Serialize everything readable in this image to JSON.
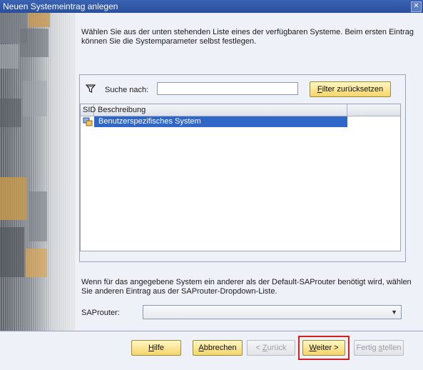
{
  "window": {
    "title": "Neuen Systemeintrag anlegen",
    "close_glyph": "✕"
  },
  "intro_text": "Wählen Sie aus der unten stehenden Liste eines der verfügbaren Systeme. Beim ersten Eintrag können Sie die Systemparameter selbst festlegen.",
  "search": {
    "label": "Suche nach:",
    "value": "",
    "placeholder": "",
    "icon": "filter-icon"
  },
  "filter_reset_button": {
    "label_accel": "F",
    "label_rest": "ilter zurücksetzen"
  },
  "table": {
    "columns": [
      "SID",
      "Beschreibung"
    ],
    "rows": [
      {
        "sid_icon": "system-icon",
        "description": "Benutzerspezifisches System",
        "selected": true
      }
    ]
  },
  "saprouter": {
    "info_text": "Wenn für das angegebene System ein anderer als der Default-SAProuter benötigt wird, wählen Sie anderen Eintrag aus der SAProuter-Dropdown-Liste.",
    "label": "SAProuter:",
    "value": ""
  },
  "buttons": {
    "help": {
      "accel": "H",
      "rest": "ilfe"
    },
    "cancel": {
      "accel": "A",
      "rest": "bbrechen"
    },
    "back": {
      "pre": "< ",
      "accel": "Z",
      "rest": "urück",
      "disabled": true
    },
    "next": {
      "accel": "W",
      "rest": "eiter >",
      "highlighted": true
    },
    "finish": {
      "pre": "Fertig ",
      "accel": "s",
      "rest": "tellen",
      "disabled": true
    }
  },
  "colors": {
    "selection": "#2f66c8",
    "button_face": "#f4d56a",
    "highlight_border": "#d22020",
    "title_bar": "#2a4f9c"
  }
}
